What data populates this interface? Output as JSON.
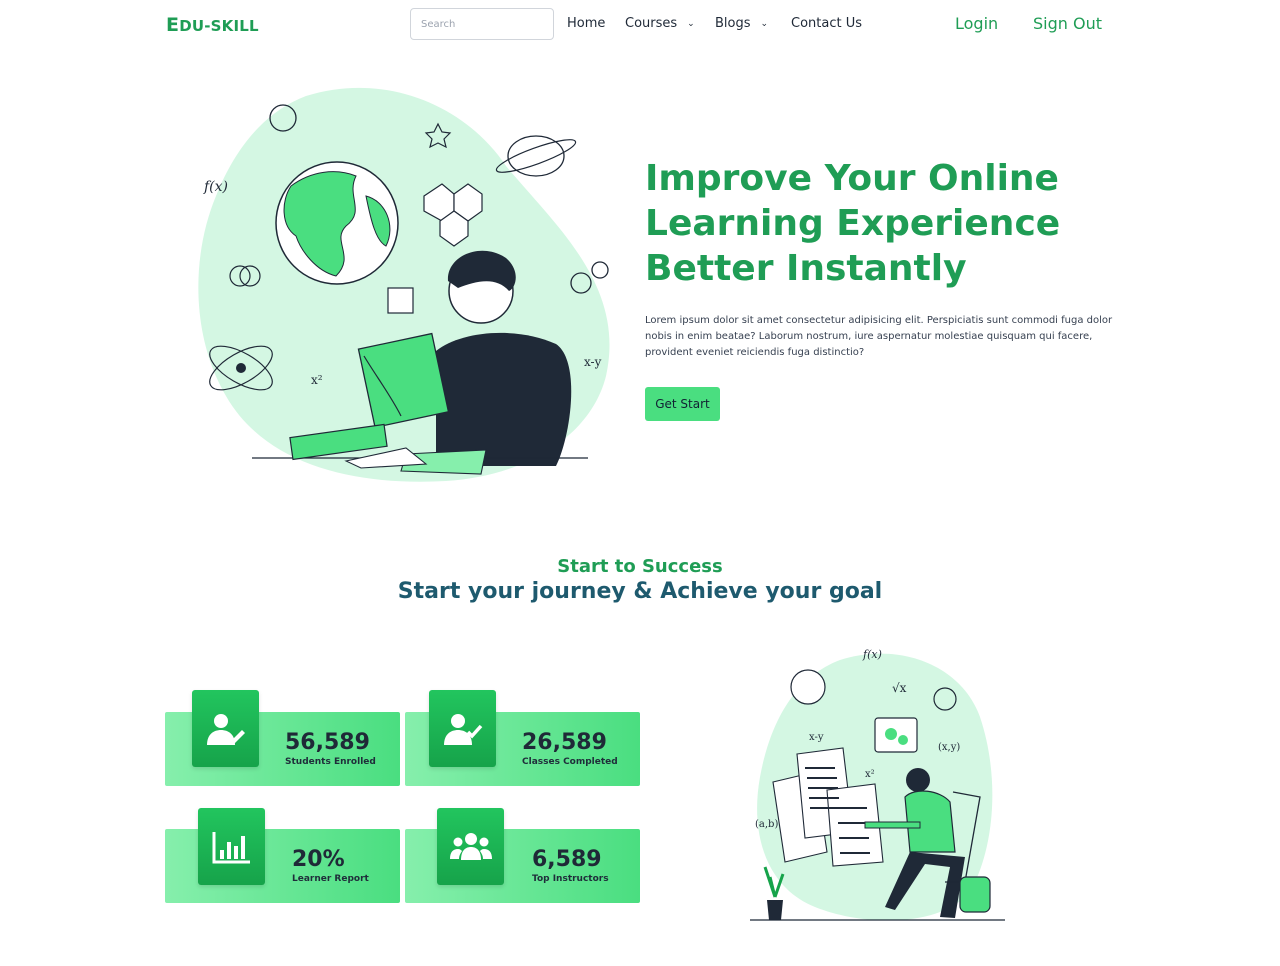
{
  "brand": {
    "logo_first": "E",
    "logo_rest": "DU-SKILL",
    "color": "#1f9d55"
  },
  "nav": {
    "search_placeholder": "Search",
    "links": [
      {
        "label": "Home"
      },
      {
        "label": "Courses",
        "icon": "chevron-down-icon"
      },
      {
        "label": "Blogs",
        "icon": "chevron-down-icon"
      },
      {
        "label": "Contact Us"
      }
    ],
    "login": "Login",
    "signout": "Sign Out"
  },
  "hero": {
    "title_lines": [
      "Improve Your Online",
      "Learning Experience",
      "Better Instantly"
    ],
    "text": "Lorem ipsum dolor sit amet consectetur adipisicing elit. Perspiciatis sunt commodi fuga dolor nobis in enim beatae? Laborum nostrum, iure aspernatur molestiae quisquam qui facere, provident eveniet reiciendis fuga distinctio?",
    "button": "Get Start"
  },
  "section": {
    "subtitle": "Start to Success",
    "title": "Start your journey & Achieve your goal"
  },
  "stats": [
    {
      "value": "56,589",
      "label": "Students Enrolled",
      "icon": "student-edit-icon"
    },
    {
      "value": "26,589",
      "label": "Classes Completed",
      "icon": "student-check-icon"
    },
    {
      "value": "20%",
      "label": "Learner Report",
      "icon": "bar-chart-icon"
    },
    {
      "value": "6,589",
      "label": "Top Instructors",
      "icon": "users-group-icon"
    }
  ],
  "colors": {
    "accent": "#1f9d55",
    "button": "#4ade80",
    "heading": "#1e5a6e",
    "blob": "#d4f7e3"
  }
}
